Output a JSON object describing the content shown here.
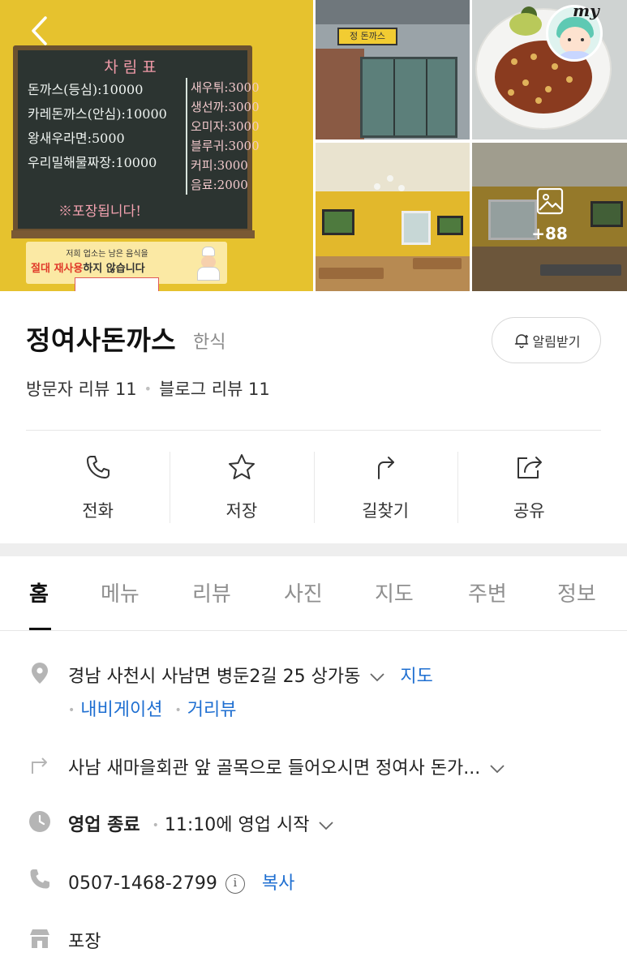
{
  "gallery": {
    "menu_board": {
      "title": "차림표",
      "items": [
        {
          "name": "돈까스(등심)",
          "price": "10000"
        },
        {
          "name": "카레돈까스(안심)",
          "price": "10000"
        },
        {
          "name": "왕새우라면",
          "price": "5000"
        },
        {
          "name": "우리밀해물짜장",
          "price": "10000"
        }
      ],
      "side_items": [
        {
          "name": "새우튀",
          "price": "3000"
        },
        {
          "name": "생선까",
          "price": "3000"
        },
        {
          "name": "오미자",
          "price": "3000"
        },
        {
          "name": "블루귀",
          "price": "3000"
        },
        {
          "name": "커피",
          "price": "3000"
        },
        {
          "name": "음료",
          "price": "2000"
        }
      ],
      "note": "※포장됩니다!"
    },
    "notice_line1": "저희 업소는 남은 음식을",
    "notice_line2_emph": "절대 재사용",
    "notice_line2_rest": "하지 않습니다",
    "store_sign": "정 돈까스",
    "more_photos": "+88",
    "my_label": "my"
  },
  "place": {
    "name": "정여사돈까스",
    "category": "한식",
    "alarm_label": "알림받기",
    "visitor_reviews": "방문자 리뷰 11",
    "blog_reviews": "블로그 리뷰 11"
  },
  "actions": [
    {
      "label": "전화",
      "icon": "phone-icon"
    },
    {
      "label": "저장",
      "icon": "star-icon"
    },
    {
      "label": "길찾기",
      "icon": "directions-icon"
    },
    {
      "label": "공유",
      "icon": "share-icon"
    }
  ],
  "tabs": [
    {
      "label": "홈",
      "active": true
    },
    {
      "label": "메뉴",
      "active": false
    },
    {
      "label": "리뷰",
      "active": false
    },
    {
      "label": "사진",
      "active": false
    },
    {
      "label": "지도",
      "active": false
    },
    {
      "label": "주변",
      "active": false
    },
    {
      "label": "정보",
      "active": false
    }
  ],
  "info": {
    "address": "경남 사천시 사남면 병둔2길 25 상가동",
    "map_link": "지도",
    "navigation_link": "내비게이션",
    "street_view_link": "거리뷰",
    "directions_text": "사남 새마을회관 앞 골목으로 들어오시면 정여사 돈가...",
    "status": "영업 종료",
    "next_open": "11:10에 영업 시작",
    "phone": "0507-1468-2799",
    "phone_info_glyph": "i",
    "copy_link": "복사",
    "service": "포장"
  },
  "colors": {
    "link": "#1f6fd1",
    "wall_yellow": "#e6c22e",
    "icon_gray": "#b5b5b5"
  }
}
